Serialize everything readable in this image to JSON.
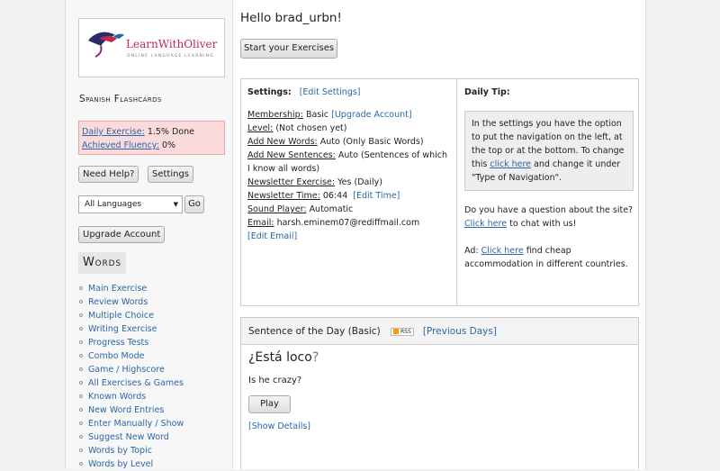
{
  "logo": {
    "name": "LearnWithOliver",
    "tagline": "ONLINE LANGUAGE LEARNING"
  },
  "sidebar": {
    "title": "Spanish Flashcards",
    "progress": {
      "exercise_label": "Daily Exercise:",
      "exercise_value": "1.5% Done",
      "fluency_label": "Achieved Fluency:",
      "fluency_value": "0%"
    },
    "buttons": {
      "help": "Need Help?",
      "settings": "Settings",
      "go": "Go",
      "upgrade": "Upgrade Account"
    },
    "language_select": {
      "selected": "All Languages"
    },
    "words_title": "Words",
    "menu": [
      "Main Exercise",
      "Review Words",
      "Multiple Choice",
      "Writing Exercise",
      "Progress Tests",
      "Combo Mode",
      "Game / Highscore",
      "All Exercises & Games",
      "Known Words",
      "New Word Entries",
      "Enter Manually / Show",
      "Suggest New Word",
      "Words by Topic",
      "Words by Level"
    ]
  },
  "main": {
    "greeting": "Hello brad_urbn!",
    "start_button": "Start your Exercises",
    "settings": {
      "header": "Settings:",
      "edit_link": "[Edit Settings]",
      "membership_label": "Membership:",
      "membership_value": "Basic",
      "upgrade_link": "[Upgrade Account]",
      "level_label": "Level:",
      "level_value": "(Not chosen yet)",
      "new_words_label": "Add New Words:",
      "new_words_value": "Auto (Only Basic Words)",
      "new_sentences_label": "Add New Sentences:",
      "new_sentences_value": "Auto (Sentences of which I know all words)",
      "newsletter_label": "Newsletter Exercise:",
      "newsletter_value": "Yes (Daily)",
      "newsletter_time_label": "Newsletter Time:",
      "newsletter_time_value": "06:44",
      "edit_time_link": "[Edit Time]",
      "sound_label": "Sound Player:",
      "sound_value": "Automatic",
      "email_label": "Email:",
      "email_value": "harsh.eminem07@rediffmail.com",
      "edit_email_link": "[Edit Email]"
    },
    "tip": {
      "header": "Daily Tip:",
      "text_before": "In the settings you have the option to put the navigation on the left, at the top or at the bottom. To change this ",
      "link": "click here",
      "text_after": " and change it under \"Type of Navigation\".",
      "question_before": "Do you have a question about the site? ",
      "question_link": "Click here",
      "question_after": " to chat with us!",
      "ad_label": "Ad: ",
      "ad_link": "Click here",
      "ad_after": " find cheap accommodation in different countries."
    },
    "sotd": {
      "title": "Sentence of the Day (Basic)",
      "rss": "RSS",
      "previous_link": "[Previous Days]",
      "sentence": "¿Está loco",
      "sentence_end": "?",
      "translation": "Is he crazy?",
      "play": "Play",
      "details_link": "[Show Details]"
    }
  },
  "colors": {
    "link": "#2b66a8",
    "progress_bg": "#fadada",
    "logo_brand": "#c0294c"
  }
}
